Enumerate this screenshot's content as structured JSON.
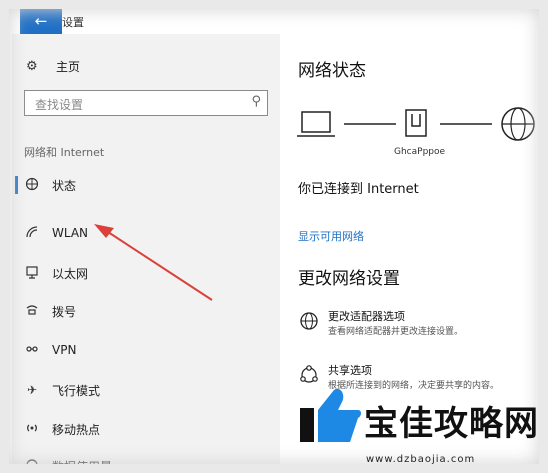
{
  "window": {
    "title": "设置",
    "back_icon": "back-arrow-icon"
  },
  "sidebar": {
    "home_label": "主页",
    "search_placeholder": "查找设置",
    "section_title": "网络和 Internet",
    "items": [
      {
        "label": "状态",
        "icon": "globe-status-icon",
        "active": true
      },
      {
        "label": "WLAN",
        "icon": "wifi-icon"
      },
      {
        "label": "以太网",
        "icon": "ethernet-icon"
      },
      {
        "label": "拨号",
        "icon": "dialup-icon"
      },
      {
        "label": "VPN",
        "icon": "vpn-icon"
      },
      {
        "label": "飞行模式",
        "icon": "airplane-icon"
      },
      {
        "label": "移动热点",
        "icon": "hotspot-icon"
      },
      {
        "label": "数据使用量",
        "icon": "data-usage-icon"
      }
    ]
  },
  "main": {
    "status_heading": "网络状态",
    "diagram": {
      "network_name": "GhcaPppoe"
    },
    "connected_text": "你已连接到 Internet",
    "show_networks_link": "显示可用网络",
    "change_heading": "更改网络设置",
    "options": [
      {
        "title": "更改适配器选项",
        "desc": "查看网络适配器并更改连接设置。",
        "icon": "adapter-globe-icon"
      },
      {
        "title": "共享选项",
        "desc": "根据所连接到的网络，决定要共享的内容。",
        "icon": "sharing-icon"
      }
    ]
  },
  "watermark": {
    "text": "宝佳攻略网",
    "url": "www.dzbaojia.com"
  },
  "colors": {
    "accent": "#1f6fc5",
    "sidebar_bg": "#f2f2f2",
    "arrow": "#d9413a"
  }
}
